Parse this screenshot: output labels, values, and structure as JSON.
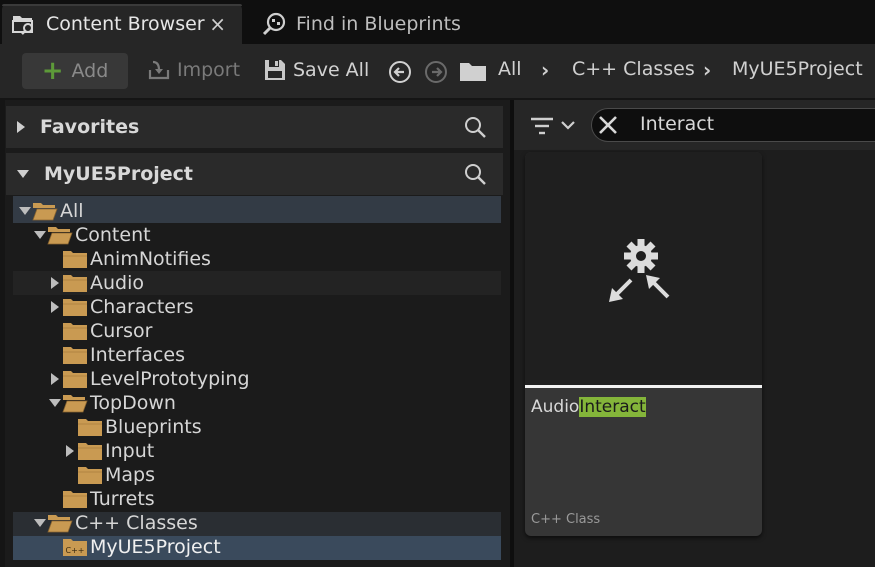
{
  "tabs": [
    {
      "label": "Content Browser",
      "icon": "content-browser-icon",
      "active": true,
      "close": "×"
    },
    {
      "label": "Find in Blueprints",
      "icon": "find-blueprints-icon",
      "active": false
    }
  ],
  "toolbar": {
    "add_label": "Add",
    "import_label": "Import",
    "save_all_label": "Save All",
    "breadcrumb": [
      "All",
      "C++ Classes",
      "MyUE5Project"
    ]
  },
  "sidebar": {
    "favorites_label": "Favorites",
    "project_label": "MyUE5Project",
    "tree": [
      {
        "label": "All",
        "depth": 0,
        "expanded": true
      },
      {
        "label": "Content",
        "depth": 1,
        "expanded": true
      },
      {
        "label": "AnimNotifies",
        "depth": 2
      },
      {
        "label": "Audio",
        "depth": 2,
        "collapsed": true
      },
      {
        "label": "Characters",
        "depth": 2,
        "collapsed": true
      },
      {
        "label": "Cursor",
        "depth": 2
      },
      {
        "label": "Interfaces",
        "depth": 2
      },
      {
        "label": "LevelPrototyping",
        "depth": 2,
        "collapsed": true
      },
      {
        "label": "TopDown",
        "depth": 2,
        "expanded": true
      },
      {
        "label": "Blueprints",
        "depth": 3
      },
      {
        "label": "Input",
        "depth": 3,
        "collapsed": true
      },
      {
        "label": "Maps",
        "depth": 3
      },
      {
        "label": "Turrets",
        "depth": 2
      },
      {
        "label": "C++ Classes",
        "depth": 1,
        "expanded": true
      },
      {
        "label": "MyUE5Project",
        "depth": 2,
        "selected": true
      }
    ]
  },
  "search": {
    "value": "Interact"
  },
  "assets": [
    {
      "name_prefix": "Audio",
      "name_match": "Interact",
      "type": "C++ Class",
      "icon": "cpp-class-gear-icon"
    }
  ],
  "colors": {
    "accent_green": "#84b53a",
    "selection": "#3a4a5c",
    "folder": "#c99a52"
  }
}
